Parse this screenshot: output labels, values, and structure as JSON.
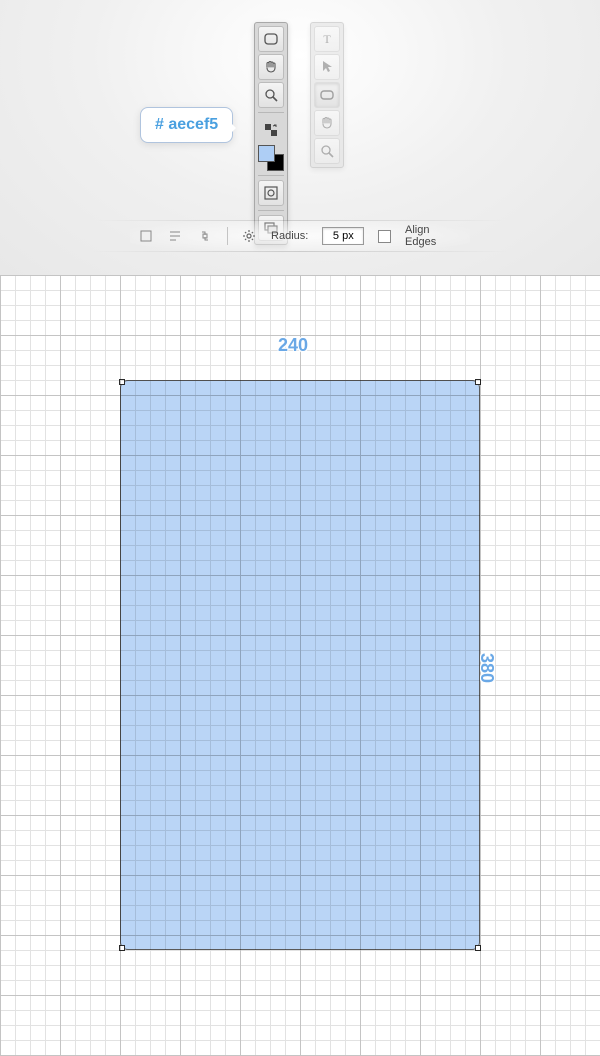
{
  "callout": {
    "color_hex": "# aecef5"
  },
  "swatch_foreground": "#aecef5",
  "options": {
    "radius_label": "Radius:",
    "radius_value": "5 px",
    "align_edges_label": "Align Edges"
  },
  "dimensions": {
    "width_label": "240",
    "height_label": "380"
  }
}
